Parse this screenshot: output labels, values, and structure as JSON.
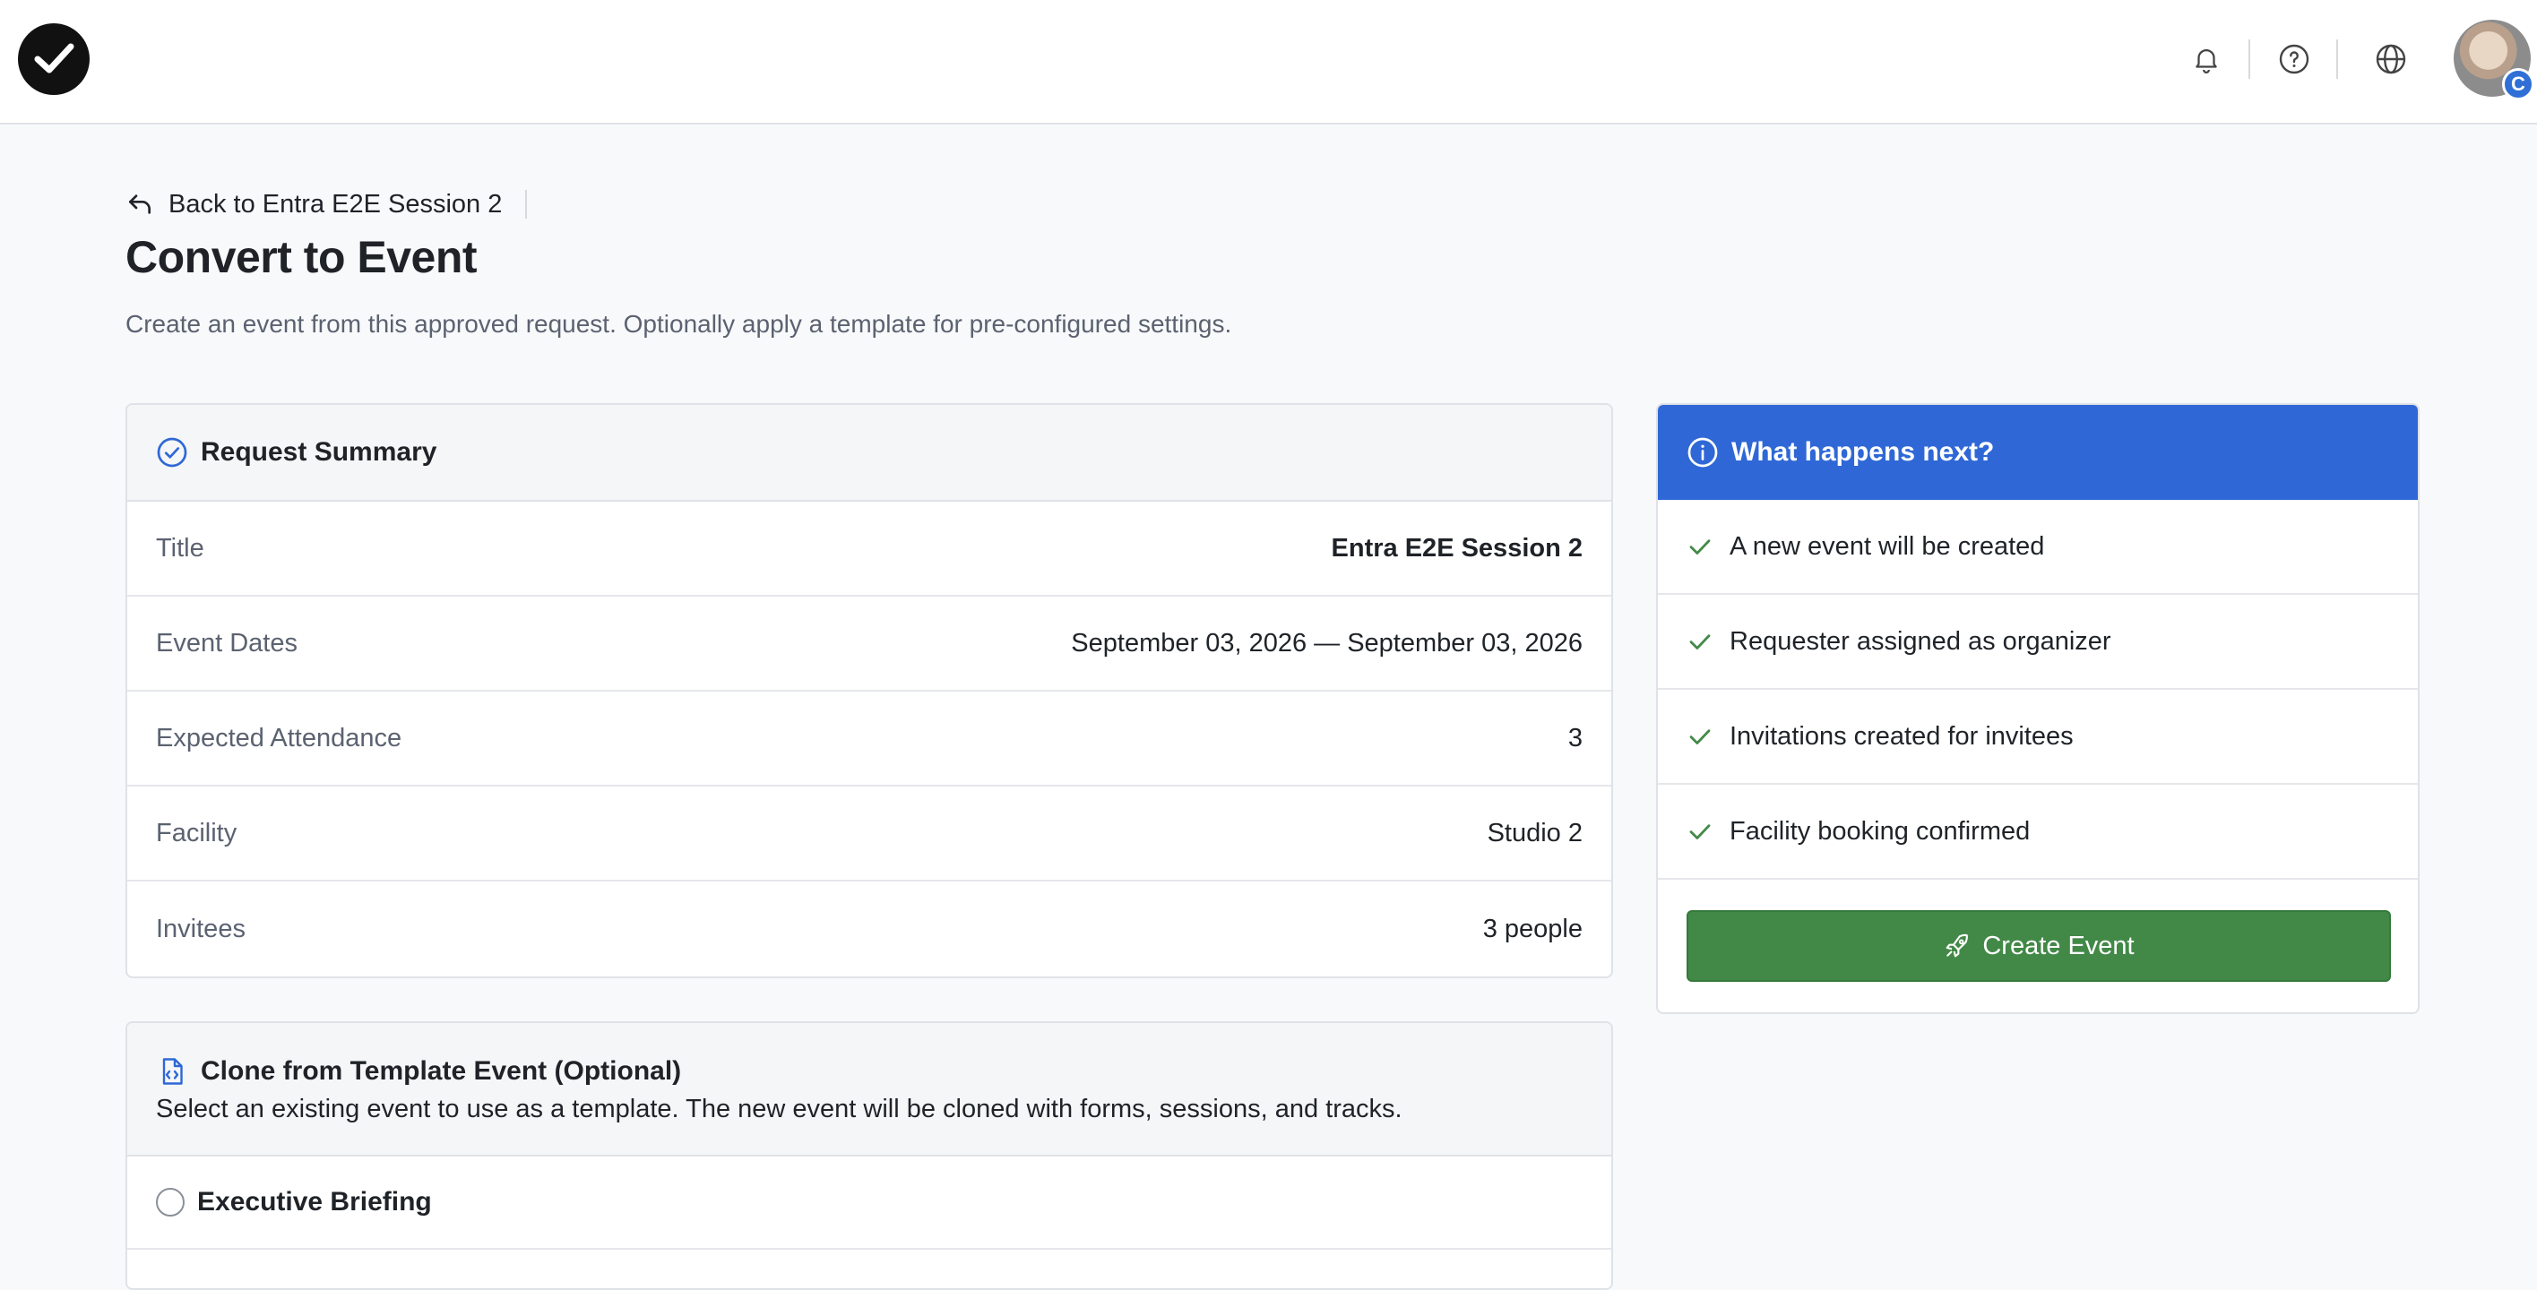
{
  "header": {
    "logo_icon": "checkmark-logo-icon",
    "icons": [
      "bell-icon",
      "help-icon",
      "globe-icon"
    ],
    "avatar_badge": "C"
  },
  "nav": {
    "back_label": "Back to Entra E2E Session 2"
  },
  "page": {
    "title": "Convert to Event",
    "subtitle": "Create an event from this approved request. Optionally apply a template for pre-configured settings."
  },
  "summary": {
    "heading": "Request Summary",
    "rows": [
      {
        "label": "Title",
        "value": "Entra E2E Session 2"
      },
      {
        "label": "Event Dates",
        "value": "September 03, 2026 — September 03, 2026"
      },
      {
        "label": "Expected Attendance",
        "value": "3"
      },
      {
        "label": "Facility",
        "value": "Studio 2"
      },
      {
        "label": "Invitees",
        "value": "3 people"
      }
    ]
  },
  "next": {
    "heading": "What happens next?",
    "items": [
      "A new event will be created",
      "Requester assigned as organizer",
      "Invitations created for invitees",
      "Facility booking confirmed"
    ],
    "button_label": "Create Event"
  },
  "template": {
    "heading": "Clone from Template Event (Optional)",
    "description": "Select an existing event to use as a template. The new event will be cloned with forms, sessions, and tracks.",
    "options": [
      "Executive Briefing"
    ]
  },
  "colors": {
    "accent_blue": "#2f68d6",
    "success_green": "#428947"
  }
}
